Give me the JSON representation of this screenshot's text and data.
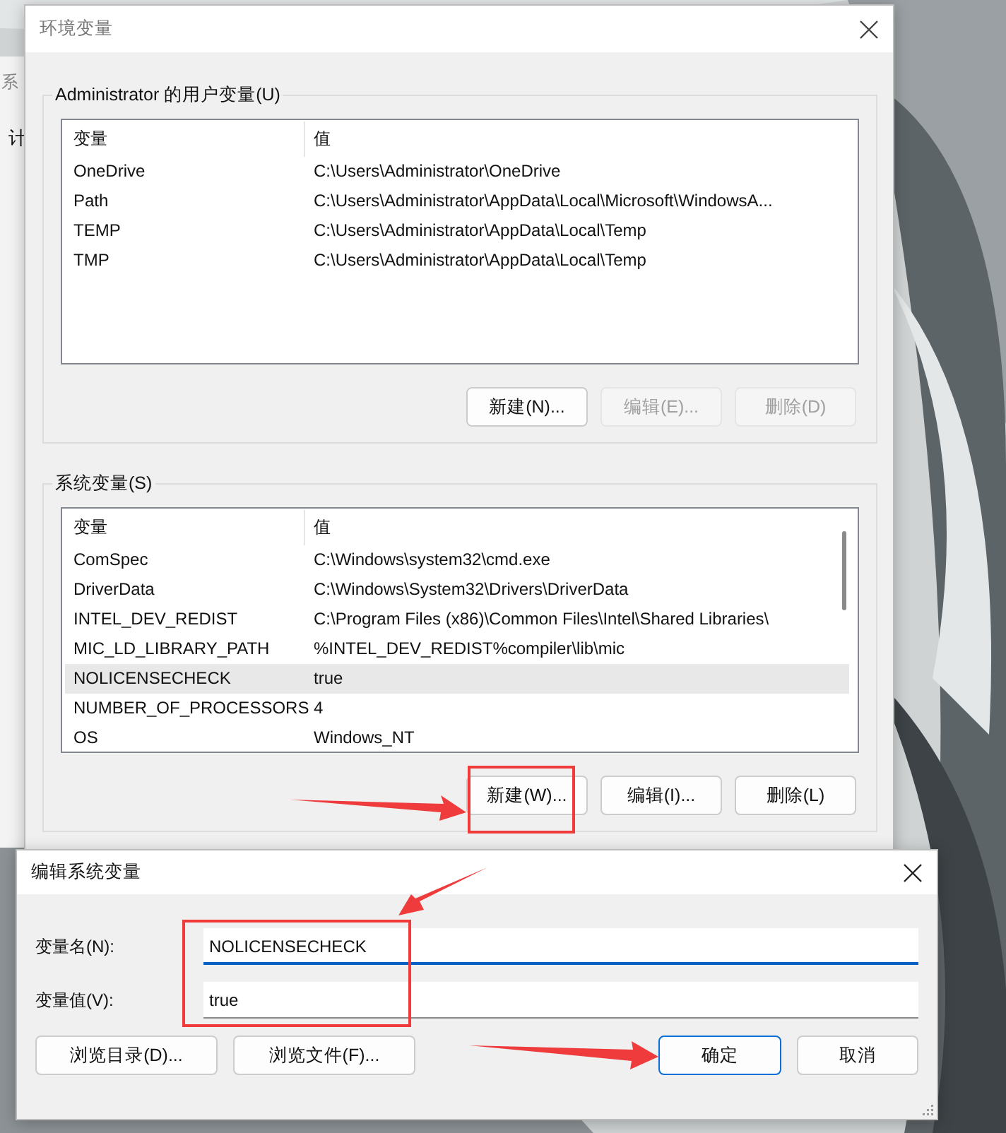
{
  "background_window": {
    "texts": [
      "系",
      "计"
    ]
  },
  "main_dialog": {
    "title": "环境变量",
    "user_vars": {
      "label": "Administrator 的用户变量(U)",
      "columns": [
        "变量",
        "值"
      ],
      "rows": [
        {
          "name": "OneDrive",
          "value": "C:\\Users\\Administrator\\OneDrive",
          "selected": false
        },
        {
          "name": "Path",
          "value": "C:\\Users\\Administrator\\AppData\\Local\\Microsoft\\WindowsA...",
          "selected": false
        },
        {
          "name": "TEMP",
          "value": "C:\\Users\\Administrator\\AppData\\Local\\Temp",
          "selected": false
        },
        {
          "name": "TMP",
          "value": "C:\\Users\\Administrator\\AppData\\Local\\Temp",
          "selected": false
        }
      ],
      "buttons": [
        {
          "label": "新建(N)...",
          "disabled": false
        },
        {
          "label": "编辑(E)...",
          "disabled": true
        },
        {
          "label": "删除(D)",
          "disabled": true
        }
      ]
    },
    "system_vars": {
      "label": "系统变量(S)",
      "columns": [
        "变量",
        "值"
      ],
      "rows": [
        {
          "name": "ComSpec",
          "value": "C:\\Windows\\system32\\cmd.exe",
          "selected": false
        },
        {
          "name": "DriverData",
          "value": "C:\\Windows\\System32\\Drivers\\DriverData",
          "selected": false
        },
        {
          "name": "INTEL_DEV_REDIST",
          "value": "C:\\Program Files (x86)\\Common Files\\Intel\\Shared Libraries\\",
          "selected": false
        },
        {
          "name": "MIC_LD_LIBRARY_PATH",
          "value": "%INTEL_DEV_REDIST%compiler\\lib\\mic",
          "selected": false
        },
        {
          "name": "NOLICENSECHECK",
          "value": "true",
          "selected": true
        },
        {
          "name": "NUMBER_OF_PROCESSORS",
          "value": "4",
          "selected": false
        },
        {
          "name": "OS",
          "value": "Windows_NT",
          "selected": false
        }
      ],
      "buttons": [
        {
          "label": "新建(W)...",
          "disabled": false
        },
        {
          "label": "编辑(I)...",
          "disabled": false
        },
        {
          "label": "删除(L)",
          "disabled": false
        }
      ]
    }
  },
  "edit_dialog": {
    "title": "编辑系统变量",
    "fields": [
      {
        "label": "变量名(N):",
        "value": "NOLICENSECHECK",
        "focused": true
      },
      {
        "label": "变量值(V):",
        "value": "true",
        "focused": false
      }
    ],
    "buttons": [
      {
        "label": "浏览目录(D)...",
        "default": false
      },
      {
        "label": "浏览文件(F)...",
        "default": false
      },
      {
        "label": "确定",
        "default": true
      },
      {
        "label": "取消",
        "default": false
      }
    ]
  }
}
